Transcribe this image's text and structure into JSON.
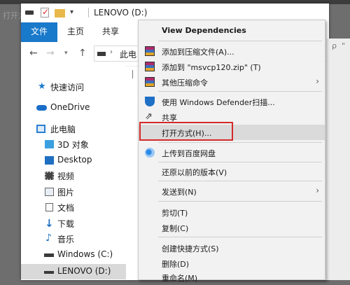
{
  "background": {
    "behind_text": "打开方"
  },
  "window": {
    "title": "LENOVO (D:)",
    "ribbon_tabs": [
      "文件",
      "主页",
      "共享"
    ],
    "address_path": "此电",
    "accent_color": "#1979ca"
  },
  "nav_pane": {
    "items": [
      {
        "label": "快速访问",
        "icon": "star-icon"
      },
      {
        "label": "OneDrive",
        "icon": "cloud-icon"
      },
      {
        "label": "此电脑",
        "icon": "computer-icon"
      },
      {
        "label": "3D 对象",
        "icon": "cube-icon"
      },
      {
        "label": "Desktop",
        "icon": "desktop-icon"
      },
      {
        "label": "视频",
        "icon": "video-icon"
      },
      {
        "label": "图片",
        "icon": "picture-icon"
      },
      {
        "label": "文档",
        "icon": "document-icon"
      },
      {
        "label": "下载",
        "icon": "download-icon"
      },
      {
        "label": "音乐",
        "icon": "music-icon"
      },
      {
        "label": "Windows (C:)",
        "icon": "drive-c-icon"
      },
      {
        "label": "LENOVO (D:)",
        "icon": "drive-d-icon"
      }
    ]
  },
  "peek_right": [
    "ρ",
    "\""
  ],
  "context_menu": {
    "view_dependencies": "View Dependencies",
    "add_to_archive": "添加到压缩文件(A)...",
    "add_to_zip": "添加到 \"msvcp120.zip\" (T)",
    "other_compress": "其他压缩命令",
    "defender_scan": "使用 Windows Defender扫描...",
    "share": "共享",
    "open_with": "打开方式(H)...",
    "upload_baidu": "上传到百度网盘",
    "restore_previous": "还原以前的版本(V)",
    "send_to": "发送到(N)",
    "cut": "剪切(T)",
    "copy": "复制(C)",
    "create_shortcut": "创建快捷方式(S)",
    "delete": "删除(D)",
    "rename": "重命名(M)",
    "highlight_color": "#d42a2a"
  }
}
